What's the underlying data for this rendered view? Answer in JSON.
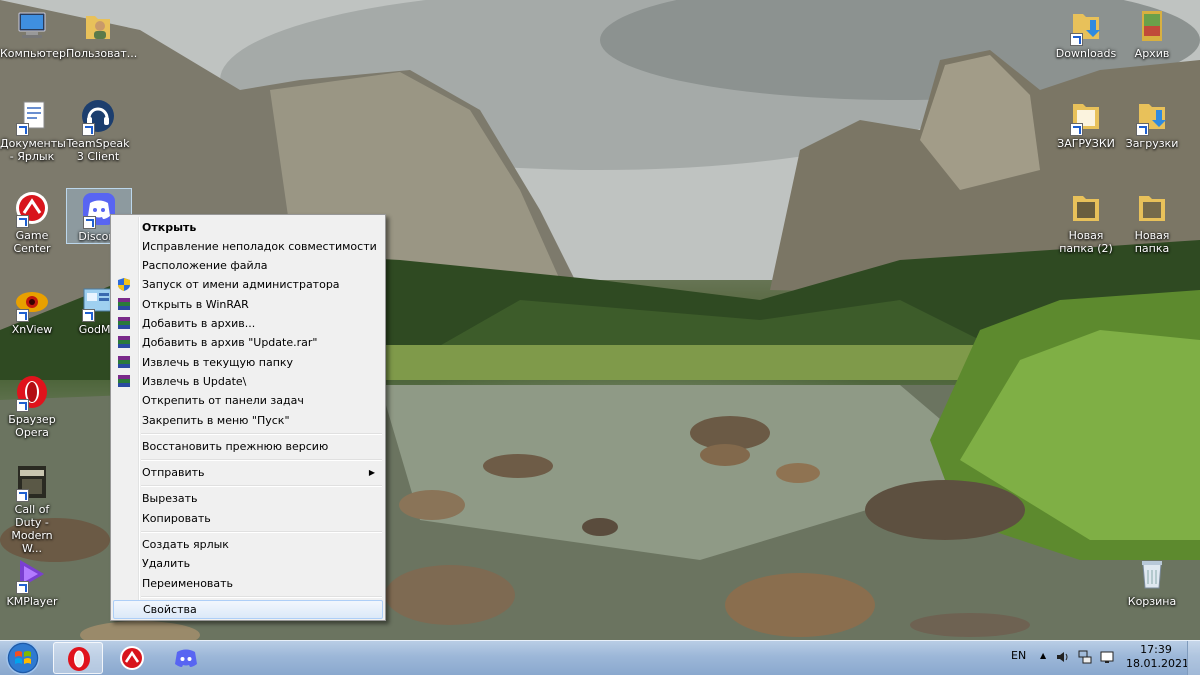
{
  "desktop_icons_left": [
    {
      "id": "computer",
      "label": "Компьютер",
      "icon": "computer-icon"
    },
    {
      "id": "user",
      "label": "Пользоват...",
      "icon": "user-folder-icon"
    },
    {
      "id": "documents",
      "label": "Документы - Ярлык",
      "icon": "documents-icon"
    },
    {
      "id": "teamspeak",
      "label": "TeamSpeak 3 Client",
      "icon": "teamspeak-icon"
    },
    {
      "id": "gamecenter",
      "label": "Game Center",
      "icon": "game-center-icon"
    },
    {
      "id": "discord",
      "label": "Discord",
      "icon": "discord-icon"
    },
    {
      "id": "xnview",
      "label": "XnView",
      "icon": "xnview-icon"
    },
    {
      "id": "godmode",
      "label": "GodMo",
      "icon": "godmode-icon"
    },
    {
      "id": "opera",
      "label": "Браузер Opera",
      "icon": "opera-icon"
    },
    {
      "id": "cod",
      "label": "Call of Duty - Modern W...",
      "icon": "call-of-duty-icon"
    },
    {
      "id": "kmplayer",
      "label": "KMPlayer",
      "icon": "kmplayer-icon"
    }
  ],
  "desktop_icons_right": [
    {
      "id": "downloads",
      "label": "Downloads",
      "icon": "downloads-folder-icon"
    },
    {
      "id": "archive",
      "label": "Архив",
      "icon": "archive-icon"
    },
    {
      "id": "zagruzki",
      "label": "ЗАГРУЗКИ",
      "icon": "folder-icon"
    },
    {
      "id": "zagruzki2",
      "label": "Загрузки",
      "icon": "downloads-folder-icon"
    },
    {
      "id": "newfolder2",
      "label": "Новая папка (2)",
      "icon": "folder-icon"
    },
    {
      "id": "newfolder",
      "label": "Новая папка",
      "icon": "folder-icon"
    },
    {
      "id": "recycle",
      "label": "Корзина",
      "icon": "recycle-bin-icon"
    }
  ],
  "context_menu": {
    "items": [
      {
        "label": "Открыть",
        "bold": true
      },
      {
        "label": "Исправление неполадок совместимости"
      },
      {
        "label": "Расположение файла"
      },
      {
        "label": "Запуск от имени администратора",
        "icon": "uac-shield-icon"
      },
      {
        "label": "Открыть в WinRAR",
        "icon": "winrar-icon"
      },
      {
        "label": "Добавить в архив...",
        "icon": "winrar-icon"
      },
      {
        "label": "Добавить в архив \"Update.rar\"",
        "icon": "winrar-icon"
      },
      {
        "label": "Извлечь в текущую папку",
        "icon": "winrar-icon"
      },
      {
        "label": "Извлечь в Update\\",
        "icon": "winrar-icon"
      },
      {
        "label": "Открепить от панели задач"
      },
      {
        "label": "Закрепить в меню \"Пуск\""
      },
      {
        "label": "Восстановить прежнюю версию"
      },
      {
        "label": "Отправить",
        "submenu": true
      },
      {
        "label": "Вырезать"
      },
      {
        "label": "Копировать"
      },
      {
        "label": "Создать ярлык"
      },
      {
        "label": "Удалить"
      },
      {
        "label": "Переименовать"
      },
      {
        "label": "Свойства",
        "highlighted": true
      }
    ]
  },
  "taskbar": {
    "pinned": [
      {
        "id": "opera",
        "icon": "opera-icon",
        "active": true
      },
      {
        "id": "gamecenter",
        "icon": "game-center-icon"
      },
      {
        "id": "discord",
        "icon": "discord-icon"
      }
    ],
    "language": "EN",
    "time": "17:39",
    "date": "18.01.2021"
  },
  "colors": {
    "menu_bg": "#f0f0f0",
    "menu_highlight_border": "#aecff7",
    "taskbar": "#9cb7d8",
    "discord": "#5865f2",
    "opera": "#e0131c"
  }
}
